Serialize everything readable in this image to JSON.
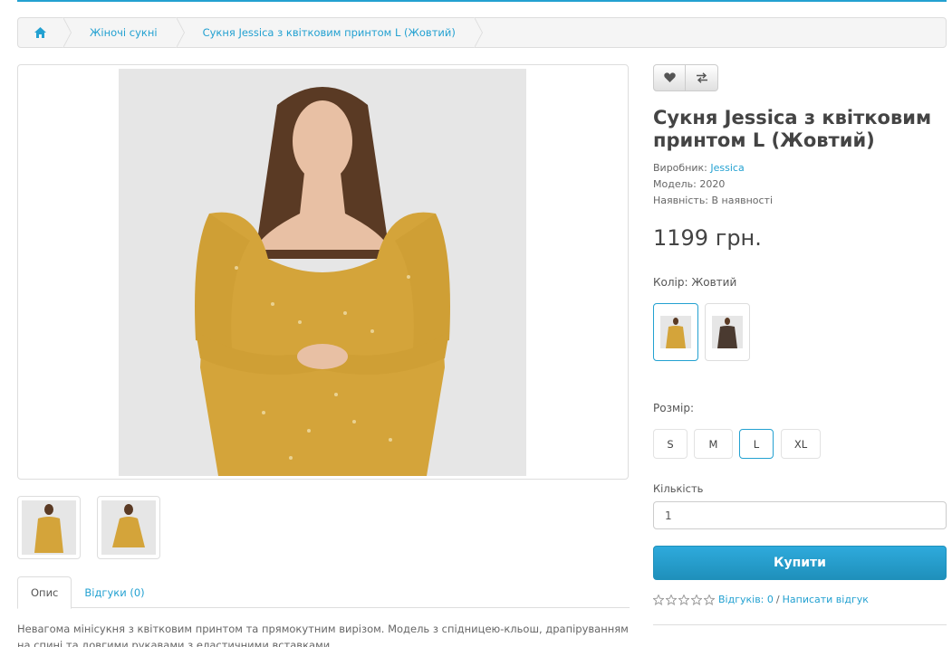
{
  "breadcrumb": {
    "home_icon": "home-icon",
    "items": [
      "Жіночі сукні",
      "Сукня Jessica з квітковим принтом L (Жовтий)"
    ]
  },
  "product": {
    "title": "Сукня Jessica з квітковим принтом L (Жовтий)",
    "manufacturer_label": "Виробник:",
    "manufacturer": "Jessica",
    "model_label": "Модель:",
    "model": "2020",
    "availability_label": "Наявність:",
    "availability": "В наявності",
    "price": "1199 грн."
  },
  "actions": {
    "wishlist_icon": "heart-icon",
    "compare_icon": "compare-icon"
  },
  "color": {
    "label": "Колір: Жовтий",
    "options": [
      "yellow-dress",
      "dark-floral-dress"
    ],
    "selected_index": 0
  },
  "size": {
    "label": "Розмір:",
    "options": [
      "S",
      "M",
      "L",
      "XL"
    ],
    "selected": "L"
  },
  "quantity": {
    "label": "Кількість",
    "value": "1"
  },
  "buy_label": "Купити",
  "rating": {
    "stars": 0,
    "reviews_link": "Відгуків: 0",
    "separator": "/",
    "write_link": "Написати відгук"
  },
  "tabs": [
    {
      "label": "Опис",
      "active": true
    },
    {
      "label": "Відгуки (0)",
      "active": false
    }
  ],
  "description": "Невагома мінісукня з квітковим принтом та прямокутним вирізом. Модель з спідницею-кльош, драпіруванням на спині та довгими рукавами з еластичними вставками.",
  "colors": {
    "accent": "#23a1d1",
    "dress_yellow": "#d4a43a",
    "dress_dark": "#4a3a30"
  }
}
